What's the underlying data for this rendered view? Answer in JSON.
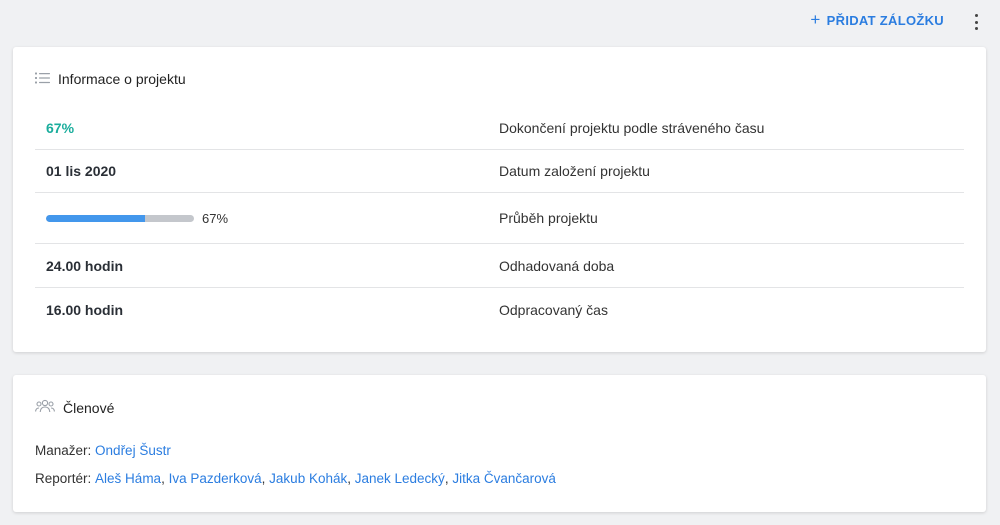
{
  "toolbar": {
    "add_tab_label": "PŘIDAT ZÁLOŽKU",
    "add_icon": "plus-icon",
    "more_icon": "kebab-icon"
  },
  "project_card": {
    "title": "Informace o projektu",
    "icon": "list-icon",
    "rows": [
      {
        "value": "67%",
        "label": "Dokončení projektu podle stráveného času"
      },
      {
        "value": "01 lis 2020",
        "label": "Datum založení projektu"
      },
      {
        "value": "67%",
        "label": "Průběh projektu",
        "progress": 0.67
      },
      {
        "value": "24.00 hodin",
        "label": "Odhadovaná doba"
      },
      {
        "value": "16.00 hodin",
        "label": "Odpracovaný čas"
      }
    ]
  },
  "members_card": {
    "title": "Členové",
    "icon": "people-group-icon",
    "manager_label": "Manažer:",
    "manager": "Ondřej Šustr",
    "reporter_label": "Reportér:",
    "reporters": [
      "Aleš Háma",
      "Iva Pazderková",
      "Jakub Kohák",
      "Janek Ledecký",
      "Jitka Čvančarová"
    ]
  },
  "colors": {
    "accent": "#2b7de0",
    "completion_green": "#1aad9c",
    "progress_fill": "#4397ec"
  }
}
